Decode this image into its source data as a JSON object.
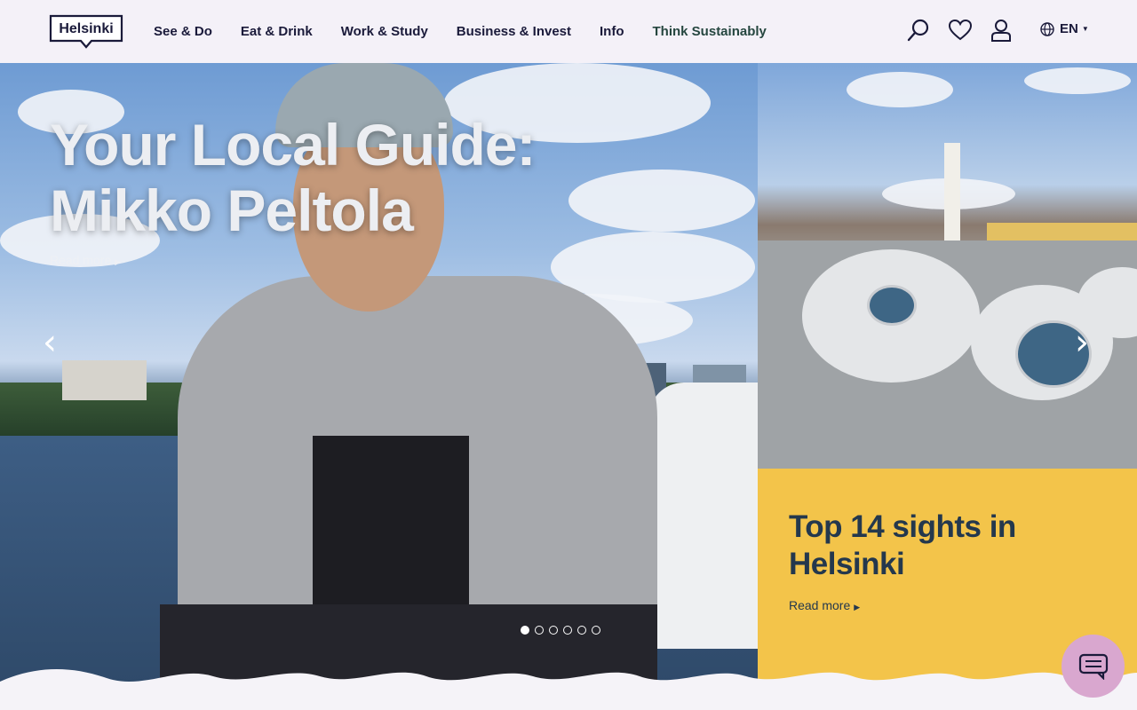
{
  "header": {
    "logo_text": "Helsinki",
    "nav": [
      "See & Do",
      "Eat & Drink",
      "Work & Study",
      "Business & Invest",
      "Info",
      "Think Sustainably"
    ],
    "icons": [
      "search-icon",
      "heart-icon",
      "user-icon",
      "globe-icon"
    ],
    "language": "EN"
  },
  "hero": {
    "title_line1": "Your Local Guide:",
    "title_line2": "Mikko Peltola",
    "read_more": "Read more",
    "slides_total": 6,
    "active_slide": 1
  },
  "side": {
    "title": "Top 14 sights in Helsinki",
    "read_more": "Read more"
  },
  "colors": {
    "header_bg": "#f4f1f8",
    "text_dark": "#1a1a3a",
    "card_yellow": "#f3c44a",
    "card_text": "#24384d",
    "chat_pink": "#d9a7cf"
  }
}
